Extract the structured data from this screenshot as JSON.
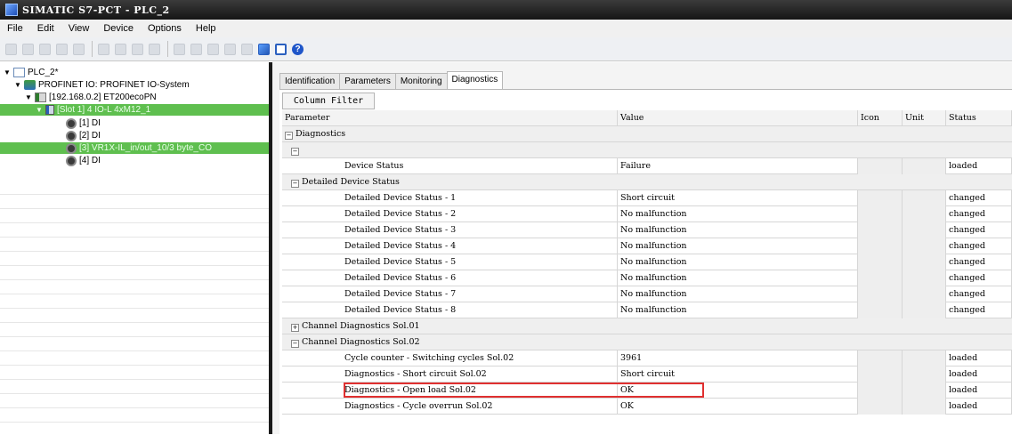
{
  "window": {
    "title": "SIMATIC S7-PCT - PLC_2"
  },
  "menu": [
    "File",
    "Edit",
    "View",
    "Device",
    "Options",
    "Help"
  ],
  "toolbar": {
    "icons": [
      "new-icon",
      "open-icon",
      "save-icon",
      "edit-icon",
      "print-icon",
      "cut-icon",
      "copy-icon",
      "paste-icon",
      "delete-icon",
      "module-a-icon",
      "module-b-icon",
      "module-c-icon",
      "module-d-icon",
      "module-e-icon",
      "online-icon",
      "monitor-icon",
      "help-icon"
    ]
  },
  "tree": {
    "items": [
      {
        "label": "PLC_2*"
      },
      {
        "label": "PROFINET IO: PROFINET IO-System"
      },
      {
        "label": "[192.168.0.2] ET200ecoPN"
      },
      {
        "label": "[Slot 1] 4 IO-L 4xM12_1"
      },
      {
        "label": "[1] DI"
      },
      {
        "label": "[2] DI"
      },
      {
        "label": "[3] VR1X-IL_in/out_10/3 byte_CO"
      },
      {
        "label": "[4] DI"
      }
    ]
  },
  "tabs": [
    "Identification",
    "Parameters",
    "Monitoring",
    "Diagnostics"
  ],
  "active_tab": "Diagnostics",
  "column_filter": "Column Filter",
  "columns": {
    "parameter": "Parameter",
    "value": "Value",
    "icon": "Icon",
    "unit": "Unit",
    "status": "Status"
  },
  "groups": {
    "diagnostics": "Diagnostics",
    "detailed": "Detailed Device Status",
    "channel01": "Channel Diagnostics Sol.01",
    "channel02": "Channel Diagnostics Sol.02"
  },
  "rows": [
    {
      "param": "Device Status",
      "value": "Failure",
      "status": "loaded"
    },
    {
      "param": "Detailed Device Status - 1",
      "value": "Short circuit",
      "status": "changed"
    },
    {
      "param": "Detailed Device Status - 2",
      "value": "No malfunction",
      "status": "changed"
    },
    {
      "param": "Detailed Device Status - 3",
      "value": "No malfunction",
      "status": "changed"
    },
    {
      "param": "Detailed Device Status - 4",
      "value": "No malfunction",
      "status": "changed"
    },
    {
      "param": "Detailed Device Status - 5",
      "value": "No malfunction",
      "status": "changed"
    },
    {
      "param": "Detailed Device Status - 6",
      "value": "No malfunction",
      "status": "changed"
    },
    {
      "param": "Detailed Device Status - 7",
      "value": "No malfunction",
      "status": "changed"
    },
    {
      "param": "Detailed Device Status - 8",
      "value": "No malfunction",
      "status": "changed"
    },
    {
      "param": "Cycle counter - Switching cycles Sol.02",
      "value": "3961",
      "status": "loaded"
    },
    {
      "param": "Diagnostics - Short circuit Sol.02",
      "value": "Short circuit",
      "status": "loaded"
    },
    {
      "param": "Diagnostics - Open load Sol.02",
      "value": "OK",
      "status": "loaded"
    },
    {
      "param": "Diagnostics - Cycle overrun Sol.02",
      "value": "OK",
      "status": "loaded"
    }
  ],
  "colors": {
    "selection": "#5fbf4f",
    "highlight": "#e03030"
  }
}
